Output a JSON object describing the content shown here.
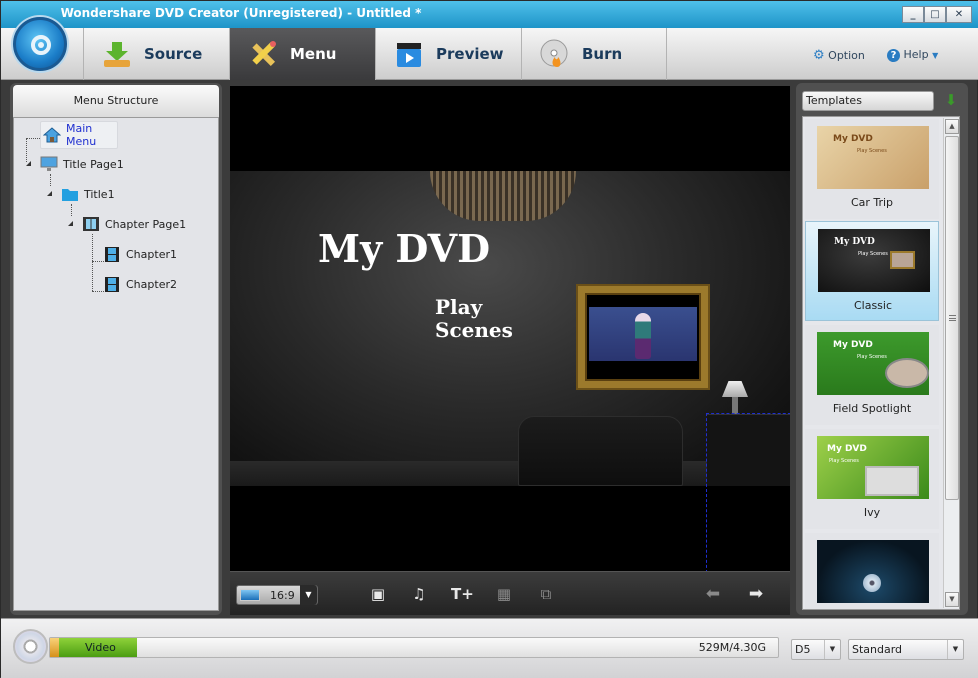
{
  "window": {
    "title": "Wondershare DVD Creator (Unregistered) - Untitled *",
    "controls": {
      "minimize": "_",
      "maximize": "□",
      "close": "✕"
    }
  },
  "nav": {
    "tabs": [
      {
        "label": "Source",
        "icon": "download-arrow-icon",
        "active": false
      },
      {
        "label": "Menu",
        "icon": "ruler-pencil-icon",
        "active": true
      },
      {
        "label": "Preview",
        "icon": "clapperboard-play-icon",
        "active": false
      },
      {
        "label": "Burn",
        "icon": "disc-flame-icon",
        "active": false
      }
    ],
    "option_label": "Option",
    "help_label": "Help"
  },
  "menu_structure": {
    "header": "Menu Structure",
    "items": [
      {
        "label": "Main Menu",
        "icon": "house-icon",
        "level": 0,
        "selected": true
      },
      {
        "label": "Title Page1",
        "icon": "monitor-icon",
        "level": 0
      },
      {
        "label": "Title1",
        "icon": "folder-icon",
        "level": 1
      },
      {
        "label": "Chapter Page1",
        "icon": "filmstrip-page-icon",
        "level": 2
      },
      {
        "label": "Chapter1",
        "icon": "film-icon",
        "level": 3
      },
      {
        "label": "Chapter2",
        "icon": "film-icon",
        "level": 3
      }
    ]
  },
  "preview": {
    "title_text": "My DVD",
    "links": [
      "Play",
      "Scenes"
    ]
  },
  "preview_toolbar": {
    "aspect_ratio": "16:9",
    "buttons": [
      {
        "name": "add-background-button",
        "icon": "picture-icon",
        "enabled": true
      },
      {
        "name": "add-music-button",
        "icon": "music-note-icon",
        "enabled": true
      },
      {
        "name": "add-text-button",
        "icon": "text-plus-icon",
        "enabled": true
      },
      {
        "name": "create-chapter-button",
        "icon": "grid-icon",
        "enabled": false
      },
      {
        "name": "add-thumbnail-button",
        "icon": "film-plus-icon",
        "enabled": false
      }
    ],
    "prev_page": "previous-arrow-icon",
    "next_page": "next-arrow-icon"
  },
  "templates": {
    "header": "Templates",
    "items": [
      {
        "name": "Car Trip",
        "selected": false,
        "thumb_title": "My DVD",
        "thumb_sub": "Play Scenes"
      },
      {
        "name": "Classic",
        "selected": true,
        "thumb_title": "My DVD",
        "thumb_sub": "Play Scenes"
      },
      {
        "name": "Field Spotlight",
        "selected": false,
        "thumb_title": "My DVD",
        "thumb_sub": "Play Scenes"
      },
      {
        "name": "Ivy",
        "selected": false,
        "thumb_title": "My DVD",
        "thumb_sub": "Play Scenes"
      },
      {
        "name": "",
        "selected": false,
        "thumb_title": "",
        "thumb_sub": ""
      }
    ]
  },
  "status": {
    "video_label": "Video",
    "capacity_text": "529M/4.30G",
    "used_fraction": 0.12,
    "disc_type": "D5",
    "quality": "Standard"
  },
  "colors": {
    "title_bar": "#1e94c8",
    "active_tab": "#3a3a3c",
    "nav_text": "#1b3b5c",
    "video_bar": "#4b9d12",
    "selection_box": "#1f2fd0",
    "selected_template": "#a9dbf3"
  }
}
